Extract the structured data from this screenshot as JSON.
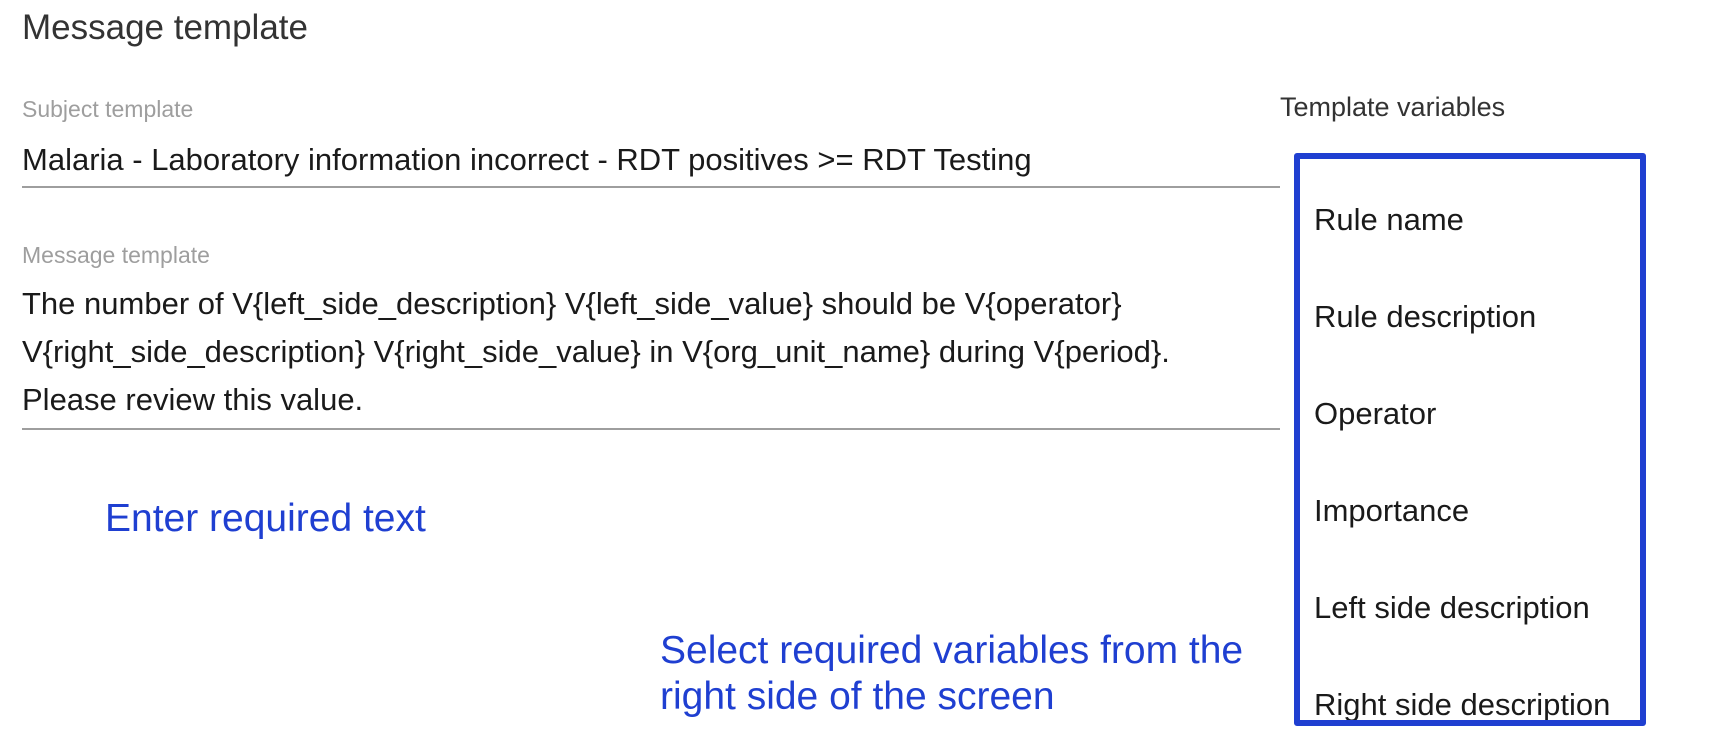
{
  "page_title": "Message template",
  "subject": {
    "label": "Subject template",
    "value": "Malaria - Laboratory information incorrect - RDT positives >= RDT Testing"
  },
  "message": {
    "label": "Message template",
    "lines": [
      "The number of V{left_side_description} V{left_side_value} should be V{operator}",
      "V{right_side_description} V{right_side_value} in V{org_unit_name} during V{period}.",
      "Please review this value."
    ]
  },
  "annotations": {
    "enter_text": "Enter required text",
    "select_vars": "Select required variables from the right side of the screen",
    "color": "#1f3fd1"
  },
  "template_variables": {
    "heading": "Template variables",
    "items": [
      "Rule name",
      "Rule description",
      "Operator",
      "Importance",
      "Left side description",
      "Right side description"
    ]
  }
}
